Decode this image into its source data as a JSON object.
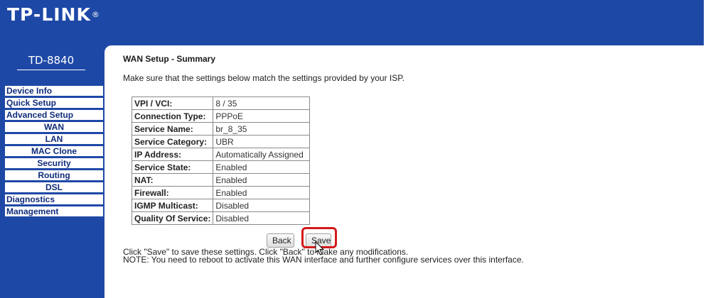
{
  "brand": {
    "logo": "TP-LINK",
    "trademark": "®",
    "model": "TD-8840"
  },
  "nav": {
    "items": [
      {
        "label": "Device Info",
        "sub": false
      },
      {
        "label": "Quick Setup",
        "sub": false
      },
      {
        "label": "Advanced Setup",
        "sub": false
      },
      {
        "label": "WAN",
        "sub": true
      },
      {
        "label": "LAN",
        "sub": true
      },
      {
        "label": "MAC Clone",
        "sub": true
      },
      {
        "label": "Security",
        "sub": true
      },
      {
        "label": "Routing",
        "sub": true
      },
      {
        "label": "DSL",
        "sub": true
      },
      {
        "label": "Diagnostics",
        "sub": false
      },
      {
        "label": "Management",
        "sub": false
      }
    ]
  },
  "page": {
    "title": "WAN Setup - Summary",
    "intro": "Make sure that the settings below match the settings provided by your ISP."
  },
  "summary": [
    {
      "label": "VPI / VCI:",
      "value": "8 / 35"
    },
    {
      "label": "Connection Type:",
      "value": "PPPoE"
    },
    {
      "label": "Service Name:",
      "value": "br_8_35"
    },
    {
      "label": "Service Category:",
      "value": "UBR"
    },
    {
      "label": "IP Address:",
      "value": "Automatically Assigned"
    },
    {
      "label": "Service State:",
      "value": "Enabled"
    },
    {
      "label": "NAT:",
      "value": "Enabled"
    },
    {
      "label": "Firewall:",
      "value": "Enabled"
    },
    {
      "label": "IGMP Multicast:",
      "value": "Disabled"
    },
    {
      "label": "Quality Of Service:",
      "value": "Disabled"
    }
  ],
  "footer": {
    "line1": "Click \"Save\" to save these settings. Click \"Back\" to make any modifications.",
    "line2": "NOTE: You need to reboot to activate this WAN interface and further configure services over this interface."
  },
  "buttons": {
    "back": "Back",
    "save": "Save"
  },
  "colors": {
    "header_bg": "#1e48a6",
    "nav_text": "#0f2b7a",
    "highlight": "#d21a1a"
  }
}
